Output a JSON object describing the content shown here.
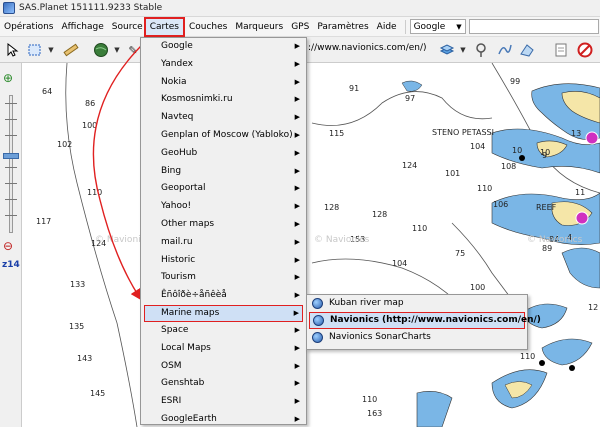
{
  "window": {
    "title": "SAS.Planet 151111.9233 Stable"
  },
  "menubar": {
    "items": [
      "Opérations",
      "Affichage",
      "Source",
      "Cartes",
      "Couches",
      "Marqueurs",
      "GPS",
      "Paramètres",
      "Aide"
    ],
    "search_provider": "Google"
  },
  "toolbar": {
    "url_partial": "://www.navionics.com/en/)"
  },
  "zoom": {
    "level_label": "z14"
  },
  "map": {
    "depths": [
      {
        "t": "64"
      },
      {
        "t": "86"
      },
      {
        "t": "100"
      },
      {
        "t": "102"
      },
      {
        "t": "110"
      },
      {
        "t": "117"
      },
      {
        "t": "124"
      },
      {
        "t": "133"
      },
      {
        "t": "135"
      },
      {
        "t": "143"
      },
      {
        "t": "145"
      },
      {
        "t": "91"
      },
      {
        "t": "99"
      },
      {
        "t": "97"
      },
      {
        "t": "115"
      },
      {
        "t": "104"
      },
      {
        "t": "108"
      },
      {
        "t": "110"
      },
      {
        "t": "124"
      },
      {
        "t": "101"
      },
      {
        "t": "128"
      },
      {
        "t": "128"
      },
      {
        "t": "153"
      },
      {
        "t": "104"
      },
      {
        "t": "110"
      },
      {
        "t": "75"
      },
      {
        "t": "84"
      },
      {
        "t": "106"
      },
      {
        "t": "100"
      },
      {
        "t": "116"
      },
      {
        "t": "110"
      },
      {
        "t": "110"
      },
      {
        "t": "163"
      },
      {
        "t": "89"
      },
      {
        "t": "10"
      },
      {
        "t": "9"
      },
      {
        "t": "13"
      },
      {
        "t": "10"
      },
      {
        "t": "11"
      },
      {
        "t": "12"
      },
      {
        "t": "4"
      }
    ],
    "labels": {
      "steno": "STENO PETASSI",
      "reef": "REEF"
    },
    "watermark": "© Navionics"
  },
  "cartes_menu": {
    "items": [
      {
        "label": "Google",
        "submenu": true
      },
      {
        "label": "Yandex",
        "submenu": true
      },
      {
        "label": "Nokia",
        "submenu": true
      },
      {
        "label": "Kosmosnimki.ru",
        "submenu": true
      },
      {
        "label": "Navteq",
        "submenu": true
      },
      {
        "label": "Genplan of Moscow (Yabloko)",
        "submenu": true
      },
      {
        "label": "GeoHub",
        "submenu": true
      },
      {
        "label": "Bing",
        "submenu": true
      },
      {
        "label": "Geoportal",
        "submenu": true
      },
      {
        "label": "Yahoo!",
        "submenu": true
      },
      {
        "label": "Other maps",
        "submenu": true
      },
      {
        "label": "mail.ru",
        "submenu": true
      },
      {
        "label": "Historic",
        "submenu": true
      },
      {
        "label": "Tourism",
        "submenu": true
      },
      {
        "label": "Êñôîðè÷åñêèå",
        "submenu": true
      },
      {
        "label": "Marine maps",
        "submenu": true,
        "highlighted": true
      },
      {
        "label": "Space",
        "submenu": true
      },
      {
        "label": "Local Maps",
        "submenu": true
      },
      {
        "label": "OSM",
        "submenu": true
      },
      {
        "label": "Genshtab",
        "submenu": true
      },
      {
        "label": "ESRI",
        "submenu": true
      },
      {
        "label": "GoogleEarth",
        "submenu": true
      }
    ]
  },
  "marine_submenu": {
    "items": [
      {
        "label": "Kuban river map"
      },
      {
        "label": "Navionics (http://www.navionics.com/en/)",
        "highlighted": true
      },
      {
        "label": "Navionics SonarCharts"
      }
    ]
  },
  "colors": {
    "accent_red": "#e02020",
    "shallow_water": "#7ab6e6",
    "land": "#f5e6a8"
  }
}
